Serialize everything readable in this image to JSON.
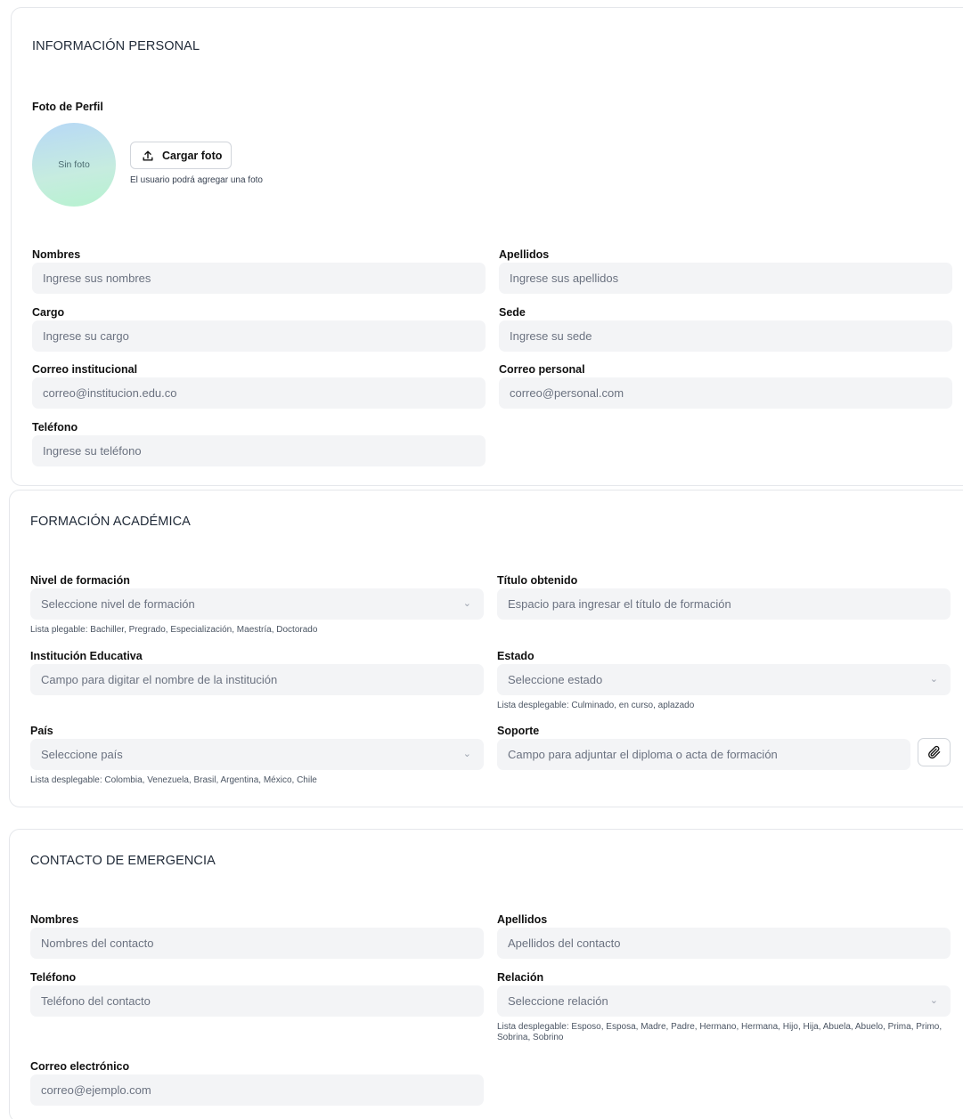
{
  "personal": {
    "section_title": "INFORMACIÓN PERSONAL",
    "photo_label": "Foto de Perfil",
    "avatar_text": "Sin foto",
    "upload_button": "Cargar foto",
    "upload_note": "El usuario podrá agregar una foto",
    "fields": {
      "nombres": {
        "label": "Nombres",
        "placeholder": "Ingrese sus nombres"
      },
      "apellidos": {
        "label": "Apellidos",
        "placeholder": "Ingrese sus apellidos"
      },
      "cargo": {
        "label": "Cargo",
        "placeholder": "Ingrese su cargo"
      },
      "sede": {
        "label": "Sede",
        "placeholder": "Ingrese su sede"
      },
      "correo_inst": {
        "label": "Correo institucional",
        "placeholder": "correo@institucion.edu.co"
      },
      "correo_pers": {
        "label": "Correo personal",
        "placeholder": "correo@personal.com"
      },
      "telefono": {
        "label": "Teléfono",
        "placeholder": "Ingrese su teléfono"
      }
    }
  },
  "academic": {
    "section_title": "FORMACIÓN ACADÉMICA",
    "fields": {
      "nivel": {
        "label": "Nivel de formación",
        "placeholder": "Seleccione nivel de formación",
        "hint": "Lista plegable: Bachiller, Pregrado, Especialización, Maestría, Doctorado"
      },
      "titulo": {
        "label": "Título obtenido",
        "placeholder": "Espacio para ingresar el título de formación"
      },
      "institucion": {
        "label": "Institución Educativa",
        "placeholder": "Campo para digitar el nombre de la institución"
      },
      "estado": {
        "label": "Estado",
        "placeholder": "Seleccione estado",
        "hint": "Lista desplegable: Culminado, en curso, aplazado"
      },
      "pais": {
        "label": "País",
        "placeholder": "Seleccione país",
        "hint": "Lista desplegable: Colombia, Venezuela, Brasil, Argentina, México, Chile"
      },
      "soporte": {
        "label": "Soporte",
        "placeholder": "Campo para adjuntar el diploma o acta de formación"
      }
    }
  },
  "emergency": {
    "section_title": "CONTACTO DE EMERGENCIA",
    "fields": {
      "nombres": {
        "label": "Nombres",
        "placeholder": "Nombres del contacto"
      },
      "apellidos": {
        "label": "Apellidos",
        "placeholder": "Apellidos del contacto"
      },
      "telefono": {
        "label": "Teléfono",
        "placeholder": "Teléfono del contacto"
      },
      "relacion": {
        "label": "Relación",
        "placeholder": "Seleccione relación",
        "hint": "Lista desplegable: Esposo, Esposa, Madre, Padre, Hermano, Hermana, Hijo, Hija, Abuela, Abuelo, Prima, Primo, Sobrina, Sobrino"
      },
      "correo": {
        "label": "Correo electrónico",
        "placeholder": "correo@ejemplo.com"
      }
    }
  },
  "icons": {
    "upload": "upload-icon",
    "chevron": "chevron-down-icon",
    "attach": "paperclip-icon"
  }
}
